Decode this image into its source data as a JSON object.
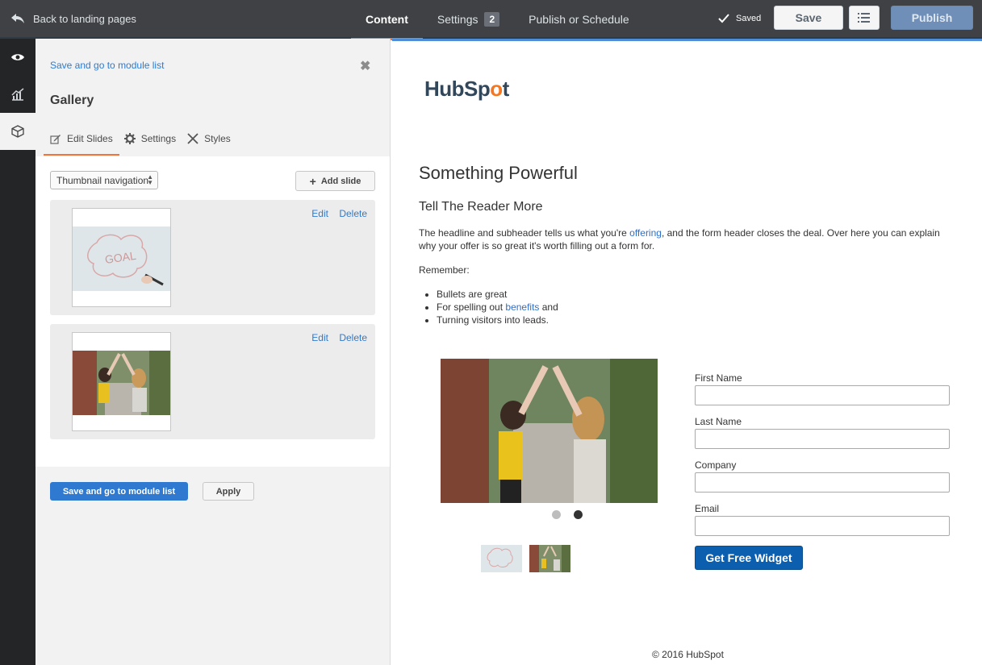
{
  "topbar": {
    "back_label": "Back to landing pages",
    "tabs": [
      {
        "label": "Content"
      },
      {
        "label": "Settings",
        "badge": "2"
      },
      {
        "label": "Publish or Schedule"
      }
    ],
    "saved_label": "Saved",
    "save_label": "Save",
    "publish_label": "Publish"
  },
  "rail": {
    "icons": [
      "eye-icon",
      "analytics-icon",
      "module-box-icon"
    ]
  },
  "panel": {
    "top_link": "Save and go to module list",
    "close_glyph": "✖",
    "title": "Gallery",
    "subtabs": [
      {
        "label": "Edit Slides",
        "icon": "edit-icon"
      },
      {
        "label": "Settings",
        "icon": "gear-icon"
      },
      {
        "label": "Styles",
        "icon": "styles-icon"
      }
    ],
    "navigation_select": "Thumbnail navigation",
    "add_slide_label": "Add slide",
    "slides": [
      {
        "edit": "Edit",
        "delete": "Delete",
        "image": "goal-whiteboard"
      },
      {
        "edit": "Edit",
        "delete": "Delete",
        "image": "high-five"
      }
    ],
    "save_button": "Save and go to module list",
    "apply_button": "Apply"
  },
  "preview": {
    "logo_text": {
      "pre": "HubSp",
      "accent": "o",
      "post": "t"
    },
    "headline": "Something Powerful",
    "subheadline": "Tell The Reader More",
    "body_pre": "The headline and subheader tells us what you're ",
    "body_link": "offering",
    "body_post": ", and the form header closes the deal. Over here you can explain why your offer is so great it's worth filling out a form for.",
    "remember": "Remember:",
    "bullet_1": "Bullets are great",
    "bullet_2_pre": "For spelling out ",
    "bullet_2_link": "benefits",
    "bullet_2_post": " and",
    "bullet_3": "Turning visitors into leads.",
    "form_fields": [
      "First Name",
      "Last Name",
      "Company",
      "Email"
    ],
    "cta_label": "Get Free Widget",
    "footer": "© 2016 HubSpot",
    "active_slide": 2
  },
  "colors": {
    "accent_orange": "#f2743a",
    "link_blue": "#2d7bd1",
    "cta_blue": "#0b5fae"
  }
}
